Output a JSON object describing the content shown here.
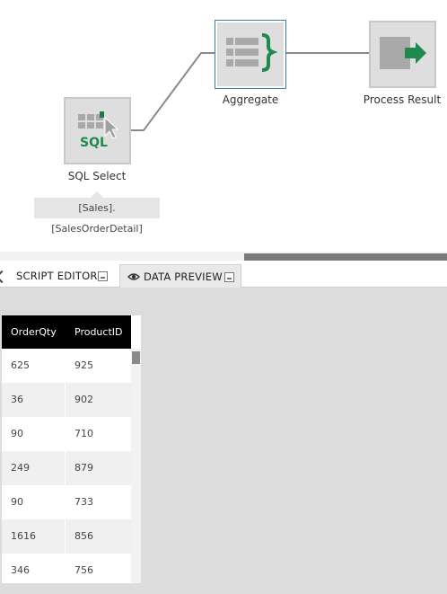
{
  "nodes": {
    "sql_select": {
      "label": "SQL Select",
      "icon": "sql-table-icon",
      "icon_text": "SQL",
      "tooltip": "[Sales].[SalesOrderDetail]"
    },
    "aggregate": {
      "label": "Aggregate",
      "icon": "aggregate-icon"
    },
    "process_result": {
      "label": "Process Result",
      "icon": "process-result-icon"
    }
  },
  "tabs": [
    {
      "label": "SCRIPT EDITOR",
      "active": false
    },
    {
      "label": "DATA PREVIEW",
      "active": true
    }
  ],
  "preview": {
    "columns": [
      "OrderQty",
      "ProductID"
    ],
    "rows": [
      [
        "625",
        "925"
      ],
      [
        "36",
        "902"
      ],
      [
        "90",
        "710"
      ],
      [
        "249",
        "879"
      ],
      [
        "90",
        "733"
      ],
      [
        "1616",
        "856"
      ],
      [
        "346",
        "756"
      ]
    ]
  },
  "colors": {
    "accent_green": "#2e8b57",
    "selection_blue": "#3b7db8",
    "header_black": "#000000"
  }
}
